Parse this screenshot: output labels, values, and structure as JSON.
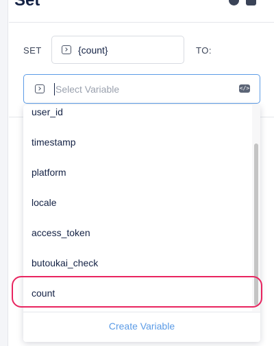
{
  "header": {
    "title": "Set"
  },
  "form": {
    "set_label": "SET",
    "set_value": "{count}",
    "to_label": "TO:",
    "select_placeholder": "Select Variable"
  },
  "dropdown": {
    "items": [
      "user_id",
      "timestamp",
      "platform",
      "locale",
      "access_token",
      "butoukai_check",
      "count"
    ],
    "create_label": "Create Variable"
  },
  "colors": {
    "accent": "#5b9be6",
    "highlight": "#e8245f",
    "text": "#132144"
  }
}
